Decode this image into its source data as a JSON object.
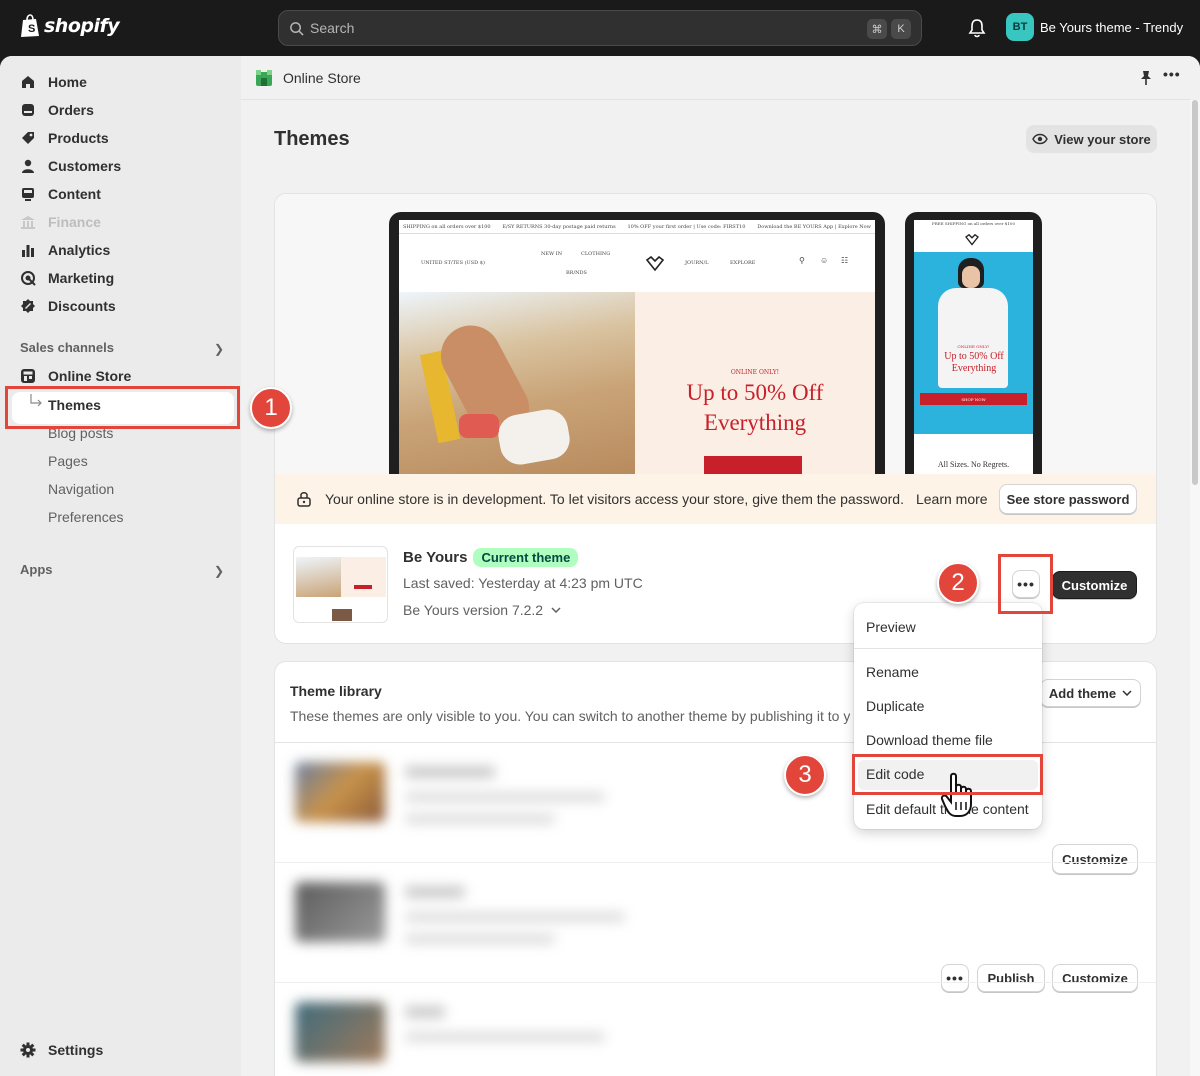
{
  "topbar": {
    "logo_text": "shopify",
    "search_placeholder": "Search",
    "shortcut_cmd": "⌘",
    "shortcut_key": "K",
    "avatar_initials": "BT",
    "store_name": "Be Yours theme - Trendy"
  },
  "sidebar": {
    "items": [
      {
        "label": "Home",
        "icon": "home-icon"
      },
      {
        "label": "Orders",
        "icon": "orders-icon"
      },
      {
        "label": "Products",
        "icon": "tag-icon"
      },
      {
        "label": "Customers",
        "icon": "person-icon"
      },
      {
        "label": "Content",
        "icon": "content-icon"
      },
      {
        "label": "Finance",
        "icon": "bank-icon"
      },
      {
        "label": "Analytics",
        "icon": "bar-chart-icon"
      },
      {
        "label": "Marketing",
        "icon": "target-icon"
      },
      {
        "label": "Discounts",
        "icon": "discount-icon"
      }
    ],
    "sales_channels_heading": "Sales channels",
    "online_store_label": "Online Store",
    "sub_items": [
      "Themes",
      "Blog posts",
      "Pages",
      "Navigation",
      "Preferences"
    ],
    "apps_heading": "Apps",
    "settings_label": "Settings"
  },
  "annotations": {
    "step1": "1",
    "step2": "2",
    "step3": "3"
  },
  "breadcrumb": {
    "title": "Online Store"
  },
  "page": {
    "title": "Themes",
    "view_store_label": "View your store"
  },
  "preview": {
    "laptop_announcement_1": "SHIPPING on all orders over $100",
    "laptop_announcement_2": "E/SY RETURNS 30-day postage paid returns",
    "laptop_announcement_3": "10% OFF your first order | Use code: FIRST10",
    "laptop_announcement_4": "Download the BE YOURS App | Explore Now",
    "nav_country": "UNITED ST/TES (USD $)",
    "nav_new_in": "NEW IN",
    "nav_clothing": "CLOTHING",
    "nav_brands": "BR/NDS",
    "nav_journal": "JOURN/L",
    "nav_explore": "EXPLORE",
    "hero_eyebrow": "ONLINE ONLY!",
    "hero_line1": "Up to 50% Off",
    "hero_line2": "Everything",
    "phone_announcement": "FREE SHIPPING on all orders over $100",
    "phone_eyebrow": "ONLINE ONLY!",
    "phone_hero": "Up to 50% Off Everything",
    "phone_shop_now": "SHOP NOW",
    "phone_tagline": "All Sizes. No Regrets."
  },
  "dev_banner": {
    "message": "Your online store is in development. To let visitors access your store, give them the password.",
    "learn_more": "Learn more",
    "button": "See store password"
  },
  "current_theme": {
    "name": "Be Yours",
    "badge": "Current theme",
    "last_saved": "Last saved: Yesterday at 4:23 pm UTC",
    "version": "Be Yours version 7.2.2",
    "customize_label": "Customize"
  },
  "menu": {
    "items": [
      "Preview",
      "Rename",
      "Duplicate",
      "Download theme file",
      "Edit code",
      "Edit default theme content"
    ]
  },
  "library": {
    "title": "Theme library",
    "description": "These themes are only visible to you. You can switch to another theme by publishing it to your store.",
    "add_theme_label": "Add theme",
    "customize_label": "Customize",
    "publish_label": "Publish",
    "dots_label": "•••"
  },
  "colors": {
    "annotation_red": "#e2463a",
    "badge_green": "#affebf",
    "hero_red": "#c8202b",
    "hero_bg": "#fbeee4",
    "phone_bg": "#2bb3dd"
  }
}
